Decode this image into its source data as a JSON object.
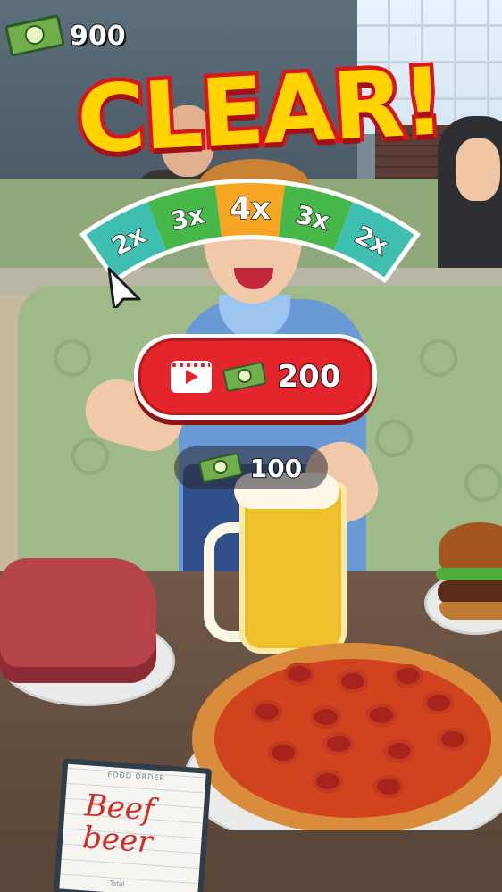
{
  "hud": {
    "money_icon": "cash-bill-icon",
    "money_total": "900"
  },
  "result": {
    "title": "CLEAR!"
  },
  "multiplier_bar": {
    "segments": [
      {
        "label": "2x",
        "color": "#3fbfb0"
      },
      {
        "label": "3x",
        "color": "#46b84a"
      },
      {
        "label": "4x",
        "color": "#f6a623"
      },
      {
        "label": "3x",
        "color": "#46b84a"
      },
      {
        "label": "2x",
        "color": "#3fbfb0"
      }
    ],
    "pointer_icon": "cursor-arrow-icon"
  },
  "ad_reward_button": {
    "icon": "video-ad-icon",
    "money_icon": "cash-bill-icon",
    "amount": "200",
    "color": "#e4262c"
  },
  "base_reward": {
    "money_icon": "cash-bill-icon",
    "amount": "100"
  },
  "order_pad": {
    "title": "FOOD ORDER",
    "lines": [
      "Beef",
      "beer"
    ],
    "total_label": "Total"
  }
}
